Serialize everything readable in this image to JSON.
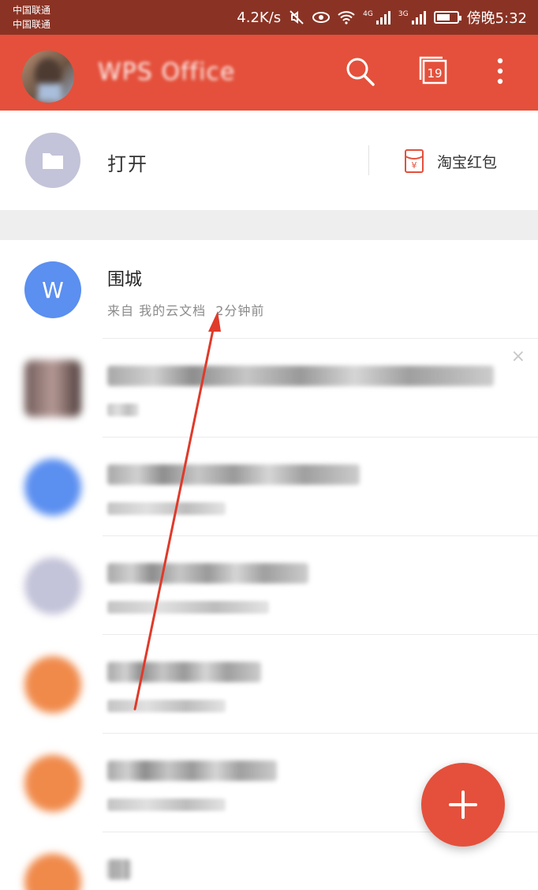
{
  "status_bar": {
    "carrier_1": "中国联通",
    "carrier_2": "中国联通",
    "net_speed": "4.2K/s",
    "sim1_network": "4G",
    "sim2_network": "3G",
    "time": "傍晚5:32"
  },
  "app_bar": {
    "title": "WPS Office",
    "calendar_day": "19",
    "icons": [
      "search-icon",
      "calendar-icon",
      "more-vertical-icon"
    ]
  },
  "open_row": {
    "label": "打开",
    "red_packet_label": "淘宝红包"
  },
  "recent_files": [
    {
      "name": "围城",
      "source": "来自 我的云文档",
      "time": "2分钟前",
      "icon_letter": "W",
      "icon_color": "#5b8ff0"
    }
  ],
  "blurred_items": [
    {
      "icon_color": "#6f5a58"
    },
    {
      "icon_color": "#5b8ff0",
      "meta_hint": "来自 QQ"
    },
    {
      "icon_color": "#c3c3d9"
    },
    {
      "icon_color": "#f08a4b"
    },
    {
      "icon_color": "#f08a4b"
    },
    {
      "icon_color": "#f08a4b"
    }
  ],
  "colors": {
    "accent": "#e4503b",
    "status_bar": "#8a3325",
    "word_blue": "#5b8ff0",
    "annotation_red": "#e03a2a"
  }
}
